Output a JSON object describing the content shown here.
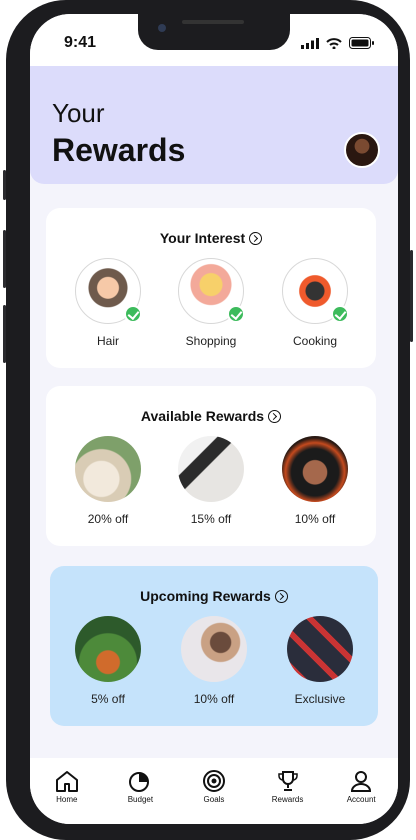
{
  "status": {
    "time": "9:41"
  },
  "header": {
    "line1": "Your",
    "line2": "Rewards"
  },
  "interest": {
    "title": "Your Interest",
    "items": [
      {
        "label": "Hair"
      },
      {
        "label": "Shopping"
      },
      {
        "label": "Cooking"
      }
    ]
  },
  "available": {
    "title": "Available Rewards",
    "items": [
      {
        "label": "20% off"
      },
      {
        "label": "15% off"
      },
      {
        "label": "10% off"
      }
    ]
  },
  "upcoming": {
    "title": "Upcoming Rewards",
    "items": [
      {
        "label": "5% off"
      },
      {
        "label": "10% off"
      },
      {
        "label": "Exclusive"
      }
    ]
  },
  "tabs": [
    {
      "label": "Home",
      "icon": "home-icon"
    },
    {
      "label": "Budget",
      "icon": "pie-chart-icon"
    },
    {
      "label": "Goals",
      "icon": "target-icon"
    },
    {
      "label": "Rewards",
      "icon": "trophy-icon"
    },
    {
      "label": "Account",
      "icon": "user-icon"
    }
  ],
  "colors": {
    "header_bg": "#dcdcfb",
    "upcoming_bg": "#c5e3fb",
    "check_green": "#3dbb5c"
  }
}
